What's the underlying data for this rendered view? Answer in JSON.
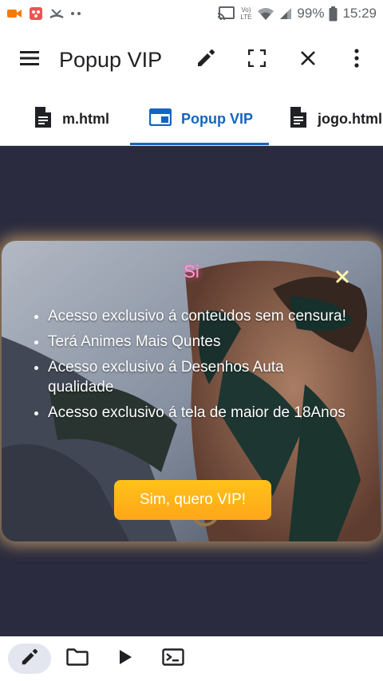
{
  "status_bar": {
    "battery_percent": "99%",
    "time": "15:29",
    "network_label": "Vo) LTE",
    "icons": [
      "video-camera-icon",
      "app-notification-icon",
      "missed-call-icon",
      "more-dots-icon",
      "cast-icon",
      "wifi-icon",
      "signal-icon",
      "battery-icon"
    ]
  },
  "toolbar": {
    "title": "Popup VIP",
    "icons": [
      "menu-icon",
      "edit-icon",
      "fullscreen-icon",
      "close-icon",
      "more-vert-icon"
    ]
  },
  "tabs": [
    {
      "label": "m.html",
      "icon": "document-icon",
      "active": false
    },
    {
      "label": "Popup VIP",
      "icon": "browser-window-icon",
      "active": true
    },
    {
      "label": "jogo.html",
      "icon": "document-icon",
      "active": false
    }
  ],
  "popup": {
    "title": "Si",
    "items": [
      "Acesso exclusivo á conteùdos sem censura!",
      "Terá Animes Mais Quntes",
      "Acesso exclusivo á Desenhos Auta qualidade",
      "Acesso exclusivo á tela de maior de 18Anos"
    ],
    "button_label": "Sim, quero VIP!"
  },
  "colors": {
    "accent": "#1565c0",
    "preview_background": "#2a2b3e",
    "vip_button": "#ffb21a",
    "popup_title": "#ff9ad0"
  },
  "bottom_bar": {
    "icons": [
      "edit-icon",
      "folder-icon",
      "play-icon",
      "terminal-icon"
    ]
  }
}
